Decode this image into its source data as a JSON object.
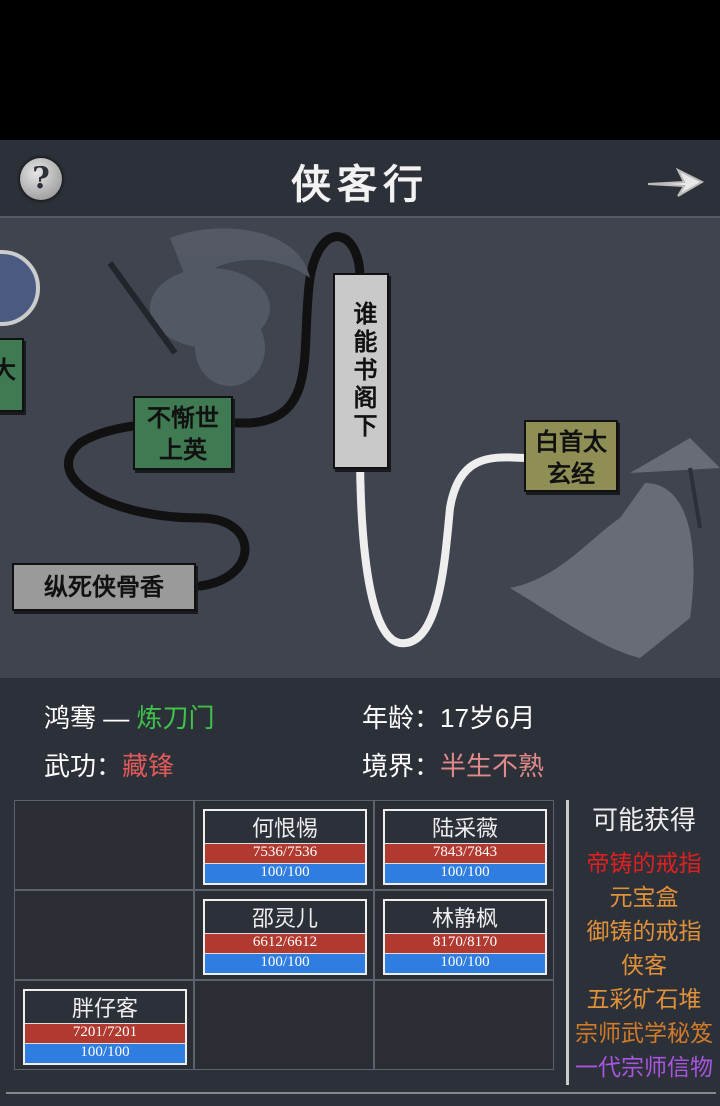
{
  "header": {
    "title": "侠客行",
    "help_icon": "?",
    "next_icon": "arrow-right-icon"
  },
  "map": {
    "nodes": [
      {
        "label": "纵死侠骨香",
        "color": "#9a9a9a"
      },
      {
        "label": "不惭世上英",
        "color": "#3f7a52"
      },
      {
        "label": "谁能书阁下",
        "color": "#c9c9c9"
      },
      {
        "label": "白首太玄经",
        "color": "#8f8f55"
      },
      {
        "label": "大",
        "color": "#3f7a52"
      }
    ]
  },
  "info": {
    "name": "鸿骞",
    "dash": "—",
    "sect": "炼刀门",
    "age_label": "年龄：",
    "age_value": "17岁6月",
    "skill_label": "武功：",
    "skill_value": "藏锋",
    "realm_label": "境界：",
    "realm_value": "半生不熟",
    "colors": {
      "sect": "#3ec24a",
      "skill": "#e05a5a",
      "realm": "#e08a8a"
    }
  },
  "party": [
    {
      "name": "何恨惕",
      "hp": "7536/7536",
      "mp": "100/100"
    },
    {
      "name": "陆采薇",
      "hp": "7843/7843",
      "mp": "100/100"
    },
    {
      "name": "邵灵儿",
      "hp": "6612/6612",
      "mp": "100/100"
    },
    {
      "name": "林静枫",
      "hp": "8170/8170",
      "mp": "100/100"
    },
    {
      "name": "胖仔客",
      "hp": "7201/7201",
      "mp": "100/100"
    }
  ],
  "loot": {
    "title": "可能获得",
    "items": [
      {
        "label": "帝铸的戒指",
        "color": "#e02020"
      },
      {
        "label": "元宝盒",
        "color": "#e0913a"
      },
      {
        "label": "御铸的戒指",
        "color": "#e0913a"
      },
      {
        "label": "侠客",
        "color": "#e0913a"
      },
      {
        "label": "五彩矿石堆",
        "color": "#e0913a"
      },
      {
        "label": "宗师武学秘笈",
        "color": "#d07a2a"
      },
      {
        "label": "一代宗师信物",
        "color": "#a855e0"
      }
    ]
  }
}
